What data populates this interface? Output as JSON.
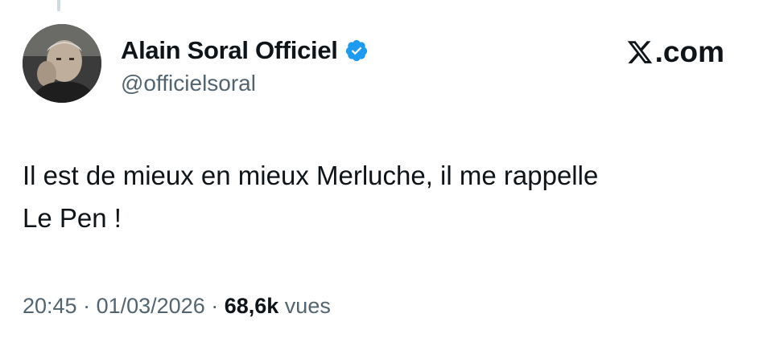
{
  "author": {
    "display_name": "Alain Soral Officiel",
    "handle": "@officielsoral",
    "verified_icon": "verified-badge-icon",
    "verified_color": "#1d9bf0"
  },
  "brand": {
    "text": ".com",
    "logo_icon": "x-logo-icon"
  },
  "tweet": {
    "line1": "Il est de mieux en mieux Merluche, il me rappelle",
    "line2": "Le Pen !"
  },
  "meta": {
    "time": "20:45",
    "separator1": " · ",
    "date": "01/03/2026",
    "separator2": " · ",
    "views_count": "68,6k",
    "views_label": " vues"
  },
  "colors": {
    "text_primary": "#0f1419",
    "text_secondary": "#536471"
  }
}
